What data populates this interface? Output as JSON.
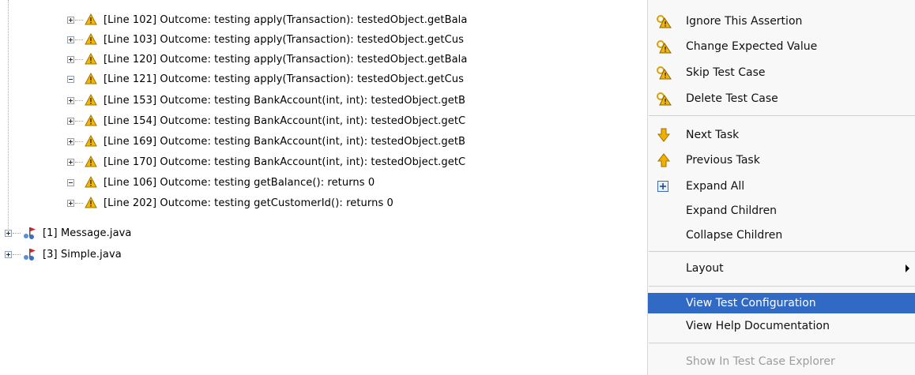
{
  "tree": {
    "rows": [
      {
        "text": "[Line 102] Outcome: testing apply(Transaction): testedObject.getBala"
      },
      {
        "text": "[Line 103] Outcome: testing apply(Transaction): testedObject.getCus"
      },
      {
        "text": "[Line 120] Outcome: testing apply(Transaction): testedObject.getBala"
      },
      {
        "text": "[Line 121] Outcome: testing apply(Transaction): testedObject.getCus"
      },
      {
        "text": "[Line 153] Outcome: testing BankAccount(int, int): testedObject.getB"
      },
      {
        "text": "[Line 154] Outcome: testing BankAccount(int, int): testedObject.getC"
      },
      {
        "text": "[Line 169] Outcome: testing BankAccount(int, int): testedObject.getB"
      },
      {
        "text": "[Line 170] Outcome: testing BankAccount(int, int): testedObject.getC"
      },
      {
        "text": "[Line 106] Outcome: testing getBalance(): returns 0"
      },
      {
        "text": "[Line 202] Outcome: testing getCustomerId(): returns 0"
      }
    ],
    "files": [
      {
        "text": "[1] Message.java"
      },
      {
        "text": "[3] Simple.java"
      }
    ]
  },
  "menu": {
    "ignore_assertion": "Ignore This Assertion",
    "change_expected": "Change Expected Value",
    "skip_test_case": "Skip Test Case",
    "delete_test_case": "Delete Test Case",
    "next_task": "Next Task",
    "previous_task": "Previous Task",
    "expand_all": "Expand All",
    "expand_children": "Expand Children",
    "collapse_children": "Collapse Children",
    "layout": "Layout",
    "view_test_config": "View Test Configuration",
    "view_help": "View Help Documentation",
    "show_in_explorer": "Show In Test Case Explorer"
  },
  "colors": {
    "highlight": "#316ac5",
    "warning": "#f2b705",
    "disabled_text": "#9c9c9c"
  }
}
